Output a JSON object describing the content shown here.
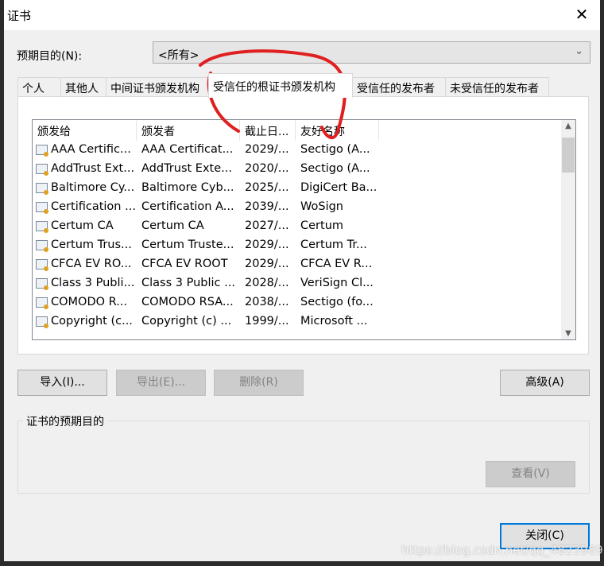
{
  "window": {
    "title": "证书",
    "close_icon": "close-icon"
  },
  "purpose": {
    "label": "预期目的(N):",
    "value": "<所有>"
  },
  "tabs": [
    {
      "label": "个人"
    },
    {
      "label": "其他人"
    },
    {
      "label": "中间证书颁发机构"
    },
    {
      "label": "受信任的根证书颁发机构",
      "active": true
    },
    {
      "label": "受信任的发布者"
    },
    {
      "label": "未受信任的发布者"
    }
  ],
  "list": {
    "columns": [
      "颁发给",
      "颁发者",
      "截止日...",
      "友好名称"
    ],
    "rows": [
      [
        "AAA Certific...",
        "AAA Certificat...",
        "2029/...",
        "Sectigo (A..."
      ],
      [
        "AddTrust Ext...",
        "AddTrust Exte...",
        "2020/...",
        "Sectigo (A..."
      ],
      [
        "Baltimore Cy...",
        "Baltimore Cyb...",
        "2025/...",
        "DigiCert Ba..."
      ],
      [
        "Certification ...",
        "Certification A...",
        "2039/...",
        "WoSign"
      ],
      [
        "Certum CA",
        "Certum CA",
        "2027/...",
        "Certum"
      ],
      [
        "Certum Trus...",
        "Certum Truste...",
        "2029/...",
        "Certum Tr..."
      ],
      [
        "CFCA EV RO...",
        "CFCA EV ROOT",
        "2029/...",
        "CFCA EV R..."
      ],
      [
        "Class 3 Publi...",
        "Class 3 Public ...",
        "2028/...",
        "VeriSign Cl..."
      ],
      [
        "COMODO R...",
        "COMODO RSA...",
        "2038/...",
        "Sectigo (fo..."
      ],
      [
        "Copyright (c...",
        "Copyright (c) ...",
        "1999/...",
        "Microsoft ..."
      ]
    ]
  },
  "buttons": {
    "import": "导入(I)...",
    "export": "导出(E)...",
    "remove": "删除(R)",
    "advanced": "高级(A)",
    "view": "查看(V)",
    "close": "关闭(C)"
  },
  "purposes_group": {
    "label": "证书的预期目的"
  },
  "watermark": "https://blog.csdn.net/qq_48239893",
  "annotation_color": "#e02020"
}
